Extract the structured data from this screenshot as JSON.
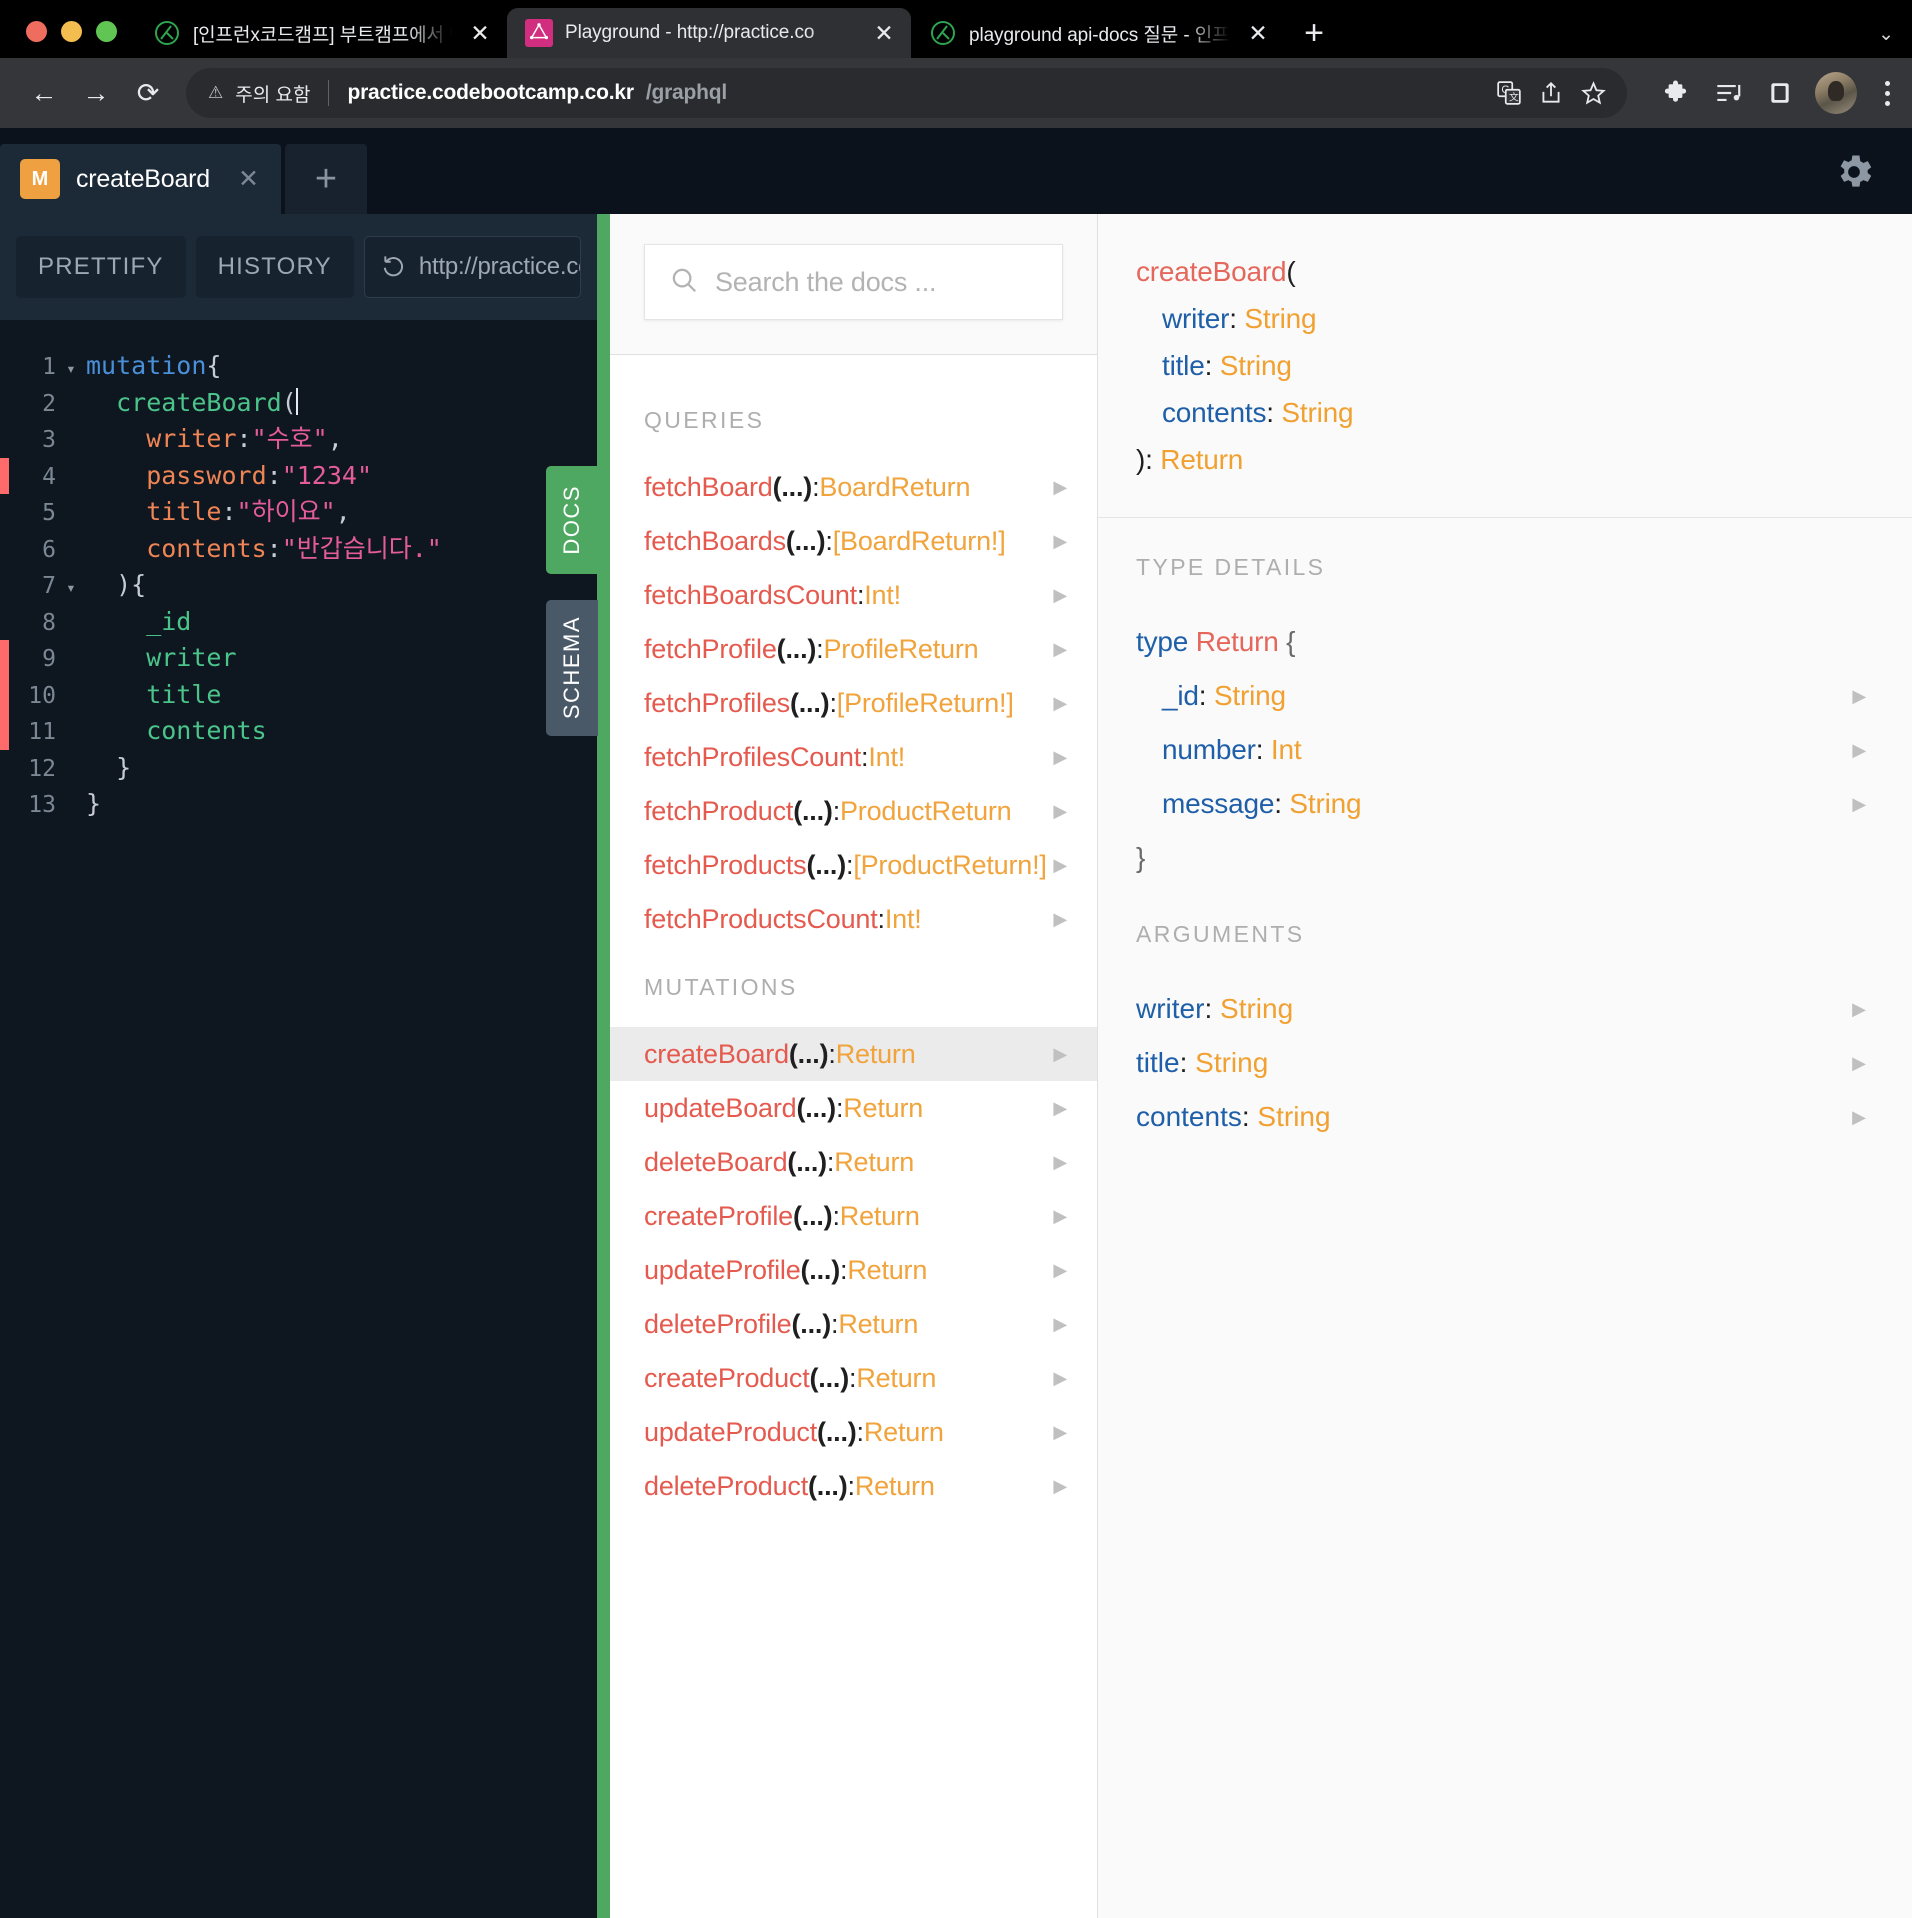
{
  "browser": {
    "tabs": [
      {
        "title": "[인프런x코드캠프] 부트캠프에서 만든",
        "favicon": "inflearn-icon",
        "active": false
      },
      {
        "title": "Playground - http://practice.co",
        "favicon": "graphql-icon",
        "active": true
      },
      {
        "title": "playground api-docs 질문 - 인프",
        "favicon": "inflearn-icon",
        "active": false
      }
    ],
    "close_label": "✕",
    "new_tab_label": "+",
    "tab_list_chevron": "⌄",
    "nav": {
      "back": "←",
      "forward": "→",
      "reload": "⟳"
    },
    "omnibox": {
      "warning_icon": "warning-triangle-icon",
      "warning_text": "주의 요함",
      "url_host": "practice.codebootcamp.co.kr",
      "url_path": "/graphql",
      "icons": [
        "translate-icon",
        "share-icon",
        "bookmark-star-icon"
      ]
    },
    "toolbar_icons": [
      "extensions-puzzle-icon",
      "media-playlist-icon",
      "side-panel-icon",
      "profile-avatar",
      "kebab-menu-icon"
    ]
  },
  "playground": {
    "tab": {
      "badge": "M",
      "title": "createBoard",
      "close": "✕"
    },
    "new_tab": "+",
    "gear_icon": "settings-gear-icon",
    "toolbar": {
      "prettify": "PRETTIFY",
      "history": "HISTORY",
      "history_icon": "history-undo-icon",
      "endpoint": "http://practice.codeboo"
    },
    "vertical_tabs": [
      {
        "label": "DOCS",
        "active": true
      },
      {
        "label": "SCHEMA",
        "active": false
      }
    ],
    "editor": {
      "lines": [
        {
          "n": "1",
          "fold": "▾",
          "error": false,
          "tokens": [
            {
              "t": "mutation",
              "c": "k-kw"
            },
            {
              "t": "{",
              "c": "k-pun"
            }
          ],
          "indent": 0
        },
        {
          "n": "2",
          "fold": "",
          "error": false,
          "tokens": [
            {
              "t": "  createBoard",
              "c": "k-fn"
            },
            {
              "t": "(",
              "c": "k-pun"
            }
          ],
          "caret": true,
          "indent": 0
        },
        {
          "n": "3",
          "fold": "",
          "error": false,
          "tokens": [
            {
              "t": "    writer",
              "c": "k-attr"
            },
            {
              "t": ":",
              "c": "k-pun"
            },
            {
              "t": "\"수호\"",
              "c": "k-str"
            },
            {
              "t": ",",
              "c": "k-pun"
            }
          ],
          "indent": 0
        },
        {
          "n": "4",
          "fold": "",
          "error": true,
          "tokens": [
            {
              "t": "    password",
              "c": "k-attr"
            },
            {
              "t": ":",
              "c": "k-pun"
            },
            {
              "t": "\"1234\"",
              "c": "k-str"
            }
          ],
          "indent": 0
        },
        {
          "n": "5",
          "fold": "",
          "error": false,
          "tokens": [
            {
              "t": "    title",
              "c": "k-attr"
            },
            {
              "t": ":",
              "c": "k-pun"
            },
            {
              "t": "\"하이요\"",
              "c": "k-str"
            },
            {
              "t": ",",
              "c": "k-pun"
            }
          ],
          "indent": 0
        },
        {
          "n": "6",
          "fold": "",
          "error": false,
          "tokens": [
            {
              "t": "    contents",
              "c": "k-attr"
            },
            {
              "t": ":",
              "c": "k-pun"
            },
            {
              "t": "\"반갑습니다.\"",
              "c": "k-str"
            }
          ],
          "indent": 0
        },
        {
          "n": "7",
          "fold": "▾",
          "error": false,
          "tokens": [
            {
              "t": "  ){",
              "c": "k-pun"
            }
          ],
          "indent": 0
        },
        {
          "n": "8",
          "fold": "",
          "error": false,
          "tokens": [
            {
              "t": "    _id",
              "c": "k-fld"
            }
          ],
          "indent": 0
        },
        {
          "n": "9",
          "fold": "",
          "error": true,
          "tokens": [
            {
              "t": "    writer",
              "c": "k-fld"
            }
          ],
          "indent": 0
        },
        {
          "n": "10",
          "fold": "",
          "error": true,
          "tokens": [
            {
              "t": "    title",
              "c": "k-fld"
            }
          ],
          "indent": 0
        },
        {
          "n": "11",
          "fold": "",
          "error": true,
          "tokens": [
            {
              "t": "    contents",
              "c": "k-fld"
            }
          ],
          "indent": 0
        },
        {
          "n": "12",
          "fold": "",
          "error": false,
          "tokens": [
            {
              "t": "  }",
              "c": "k-pun"
            }
          ],
          "indent": 0
        },
        {
          "n": "13",
          "fold": "",
          "error": false,
          "tokens": [
            {
              "t": "}",
              "c": "k-pun"
            }
          ],
          "indent": 0
        }
      ]
    },
    "docs": {
      "search_placeholder": "Search the docs ...",
      "search_icon": "search-icon",
      "search_value": "",
      "sections": [
        {
          "title": "QUERIES",
          "items": [
            {
              "name": "fetchBoard",
              "args": "(...)",
              "type": "BoardReturn",
              "active": false
            },
            {
              "name": "fetchBoards",
              "args": "(...)",
              "type": "[BoardReturn!]",
              "active": false
            },
            {
              "name": "fetchBoardsCount",
              "args": "",
              "type": "Int!",
              "active": false
            },
            {
              "name": "fetchProfile",
              "args": "(...)",
              "type": "ProfileReturn",
              "active": false
            },
            {
              "name": "fetchProfiles",
              "args": "(...)",
              "type": "[ProfileReturn!]",
              "active": false
            },
            {
              "name": "fetchProfilesCount",
              "args": "",
              "type": "Int!",
              "active": false
            },
            {
              "name": "fetchProduct",
              "args": "(...)",
              "type": "ProductReturn",
              "active": false
            },
            {
              "name": "fetchProducts",
              "args": "(...)",
              "type": "[ProductReturn!]",
              "active": false
            },
            {
              "name": "fetchProductsCount",
              "args": "",
              "type": "Int!",
              "active": false
            }
          ]
        },
        {
          "title": "MUTATIONS",
          "items": [
            {
              "name": "createBoard",
              "args": "(...)",
              "type": "Return",
              "active": true
            },
            {
              "name": "updateBoard",
              "args": "(...)",
              "type": "Return",
              "active": false
            },
            {
              "name": "deleteBoard",
              "args": "(...)",
              "type": "Return",
              "active": false
            },
            {
              "name": "createProfile",
              "args": "(...)",
              "type": "Return",
              "active": false
            },
            {
              "name": "updateProfile",
              "args": "(...)",
              "type": "Return",
              "active": false
            },
            {
              "name": "deleteProfile",
              "args": "(...)",
              "type": "Return",
              "active": false
            },
            {
              "name": "createProduct",
              "args": "(...)",
              "type": "Return",
              "active": false
            },
            {
              "name": "updateProduct",
              "args": "(...)",
              "type": "Return",
              "active": false
            },
            {
              "name": "deleteProduct",
              "args": "(...)",
              "type": "Return",
              "active": false
            }
          ]
        }
      ]
    },
    "detail": {
      "signature": {
        "name": "createBoard",
        "open_paren": "(",
        "args": [
          {
            "name": "writer",
            "type": "String"
          },
          {
            "name": "title",
            "type": "String"
          },
          {
            "name": "contents",
            "type": "String"
          }
        ],
        "close": "): ",
        "return_type": "Return"
      },
      "type_details_title": "TYPE DETAILS",
      "type_decl_kw": "type",
      "type_decl_name": "Return",
      "type_open_brace": "{",
      "type_close_brace": "}",
      "type_fields": [
        {
          "name": "_id",
          "type": "String"
        },
        {
          "name": "number",
          "type": "Int"
        },
        {
          "name": "message",
          "type": "String"
        }
      ],
      "arguments_title": "ARGUMENTS",
      "arguments": [
        {
          "name": "writer",
          "type": "String"
        },
        {
          "name": "title",
          "type": "String"
        },
        {
          "name": "contents",
          "type": "String"
        }
      ],
      "expand_arrow": "▶"
    }
  },
  "colors": {
    "accent_green": "#4fa861",
    "mutation_badge": "#efa041",
    "graphql_pink": "#d12e7f",
    "docs_name": "#e55a4e",
    "docs_type": "#f1a33c",
    "arg_blue": "#1f5fa8"
  }
}
